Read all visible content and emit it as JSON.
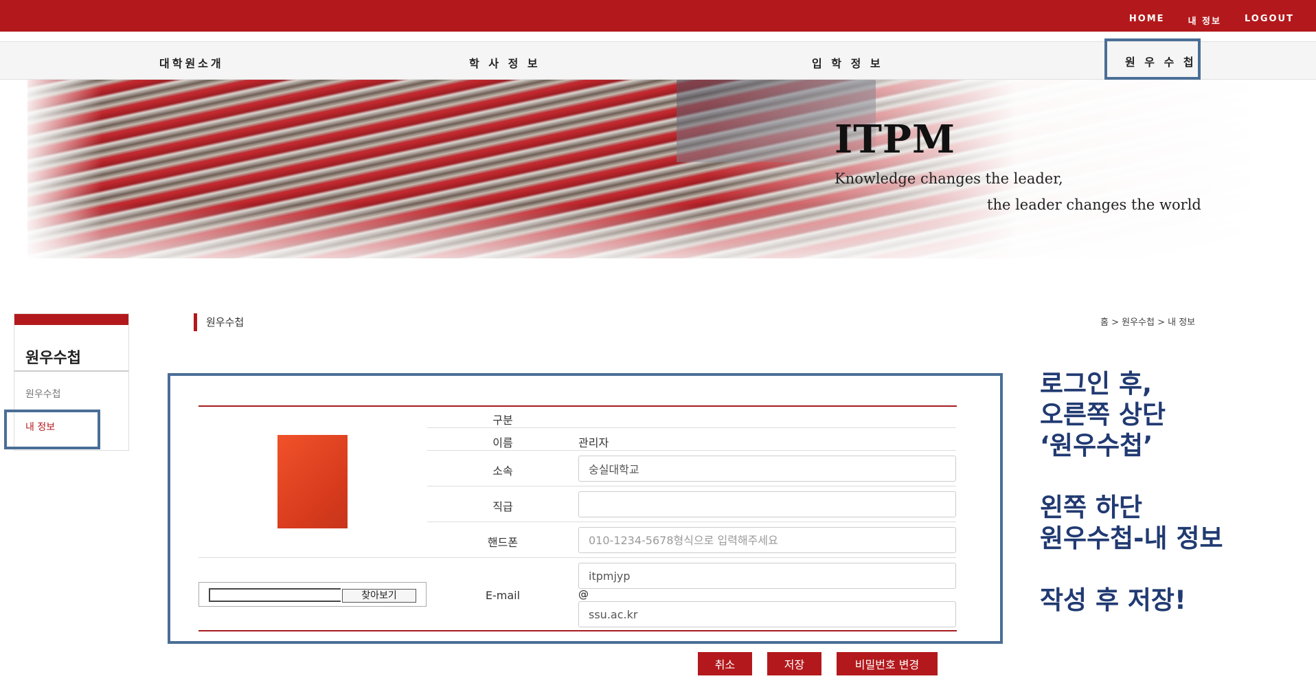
{
  "topbar": {
    "links": [
      "HOME",
      "내 정보",
      "LOGOUT"
    ]
  },
  "nav": {
    "items": [
      "대학원소개",
      "학 사 정 보",
      "입 학 정 보",
      "원 우 수 첩"
    ]
  },
  "banner": {
    "title": "ITPM",
    "tagline_1": "Knowledge changes the leader,",
    "tagline_2": "the leader changes the world"
  },
  "sidebar": {
    "title": "원우수첩",
    "items": [
      "원우수첩",
      "내 정보"
    ]
  },
  "section": {
    "title": "원우수첩",
    "breadcrumb": "홈 > 원우수첩 > 내 정보"
  },
  "form": {
    "file_button": "찾아보기",
    "rows": {
      "division": {
        "label": "구분",
        "value": ""
      },
      "name": {
        "label": "이름",
        "value": "관리자"
      },
      "affiliation": {
        "label": "소속",
        "value": "숭실대학교"
      },
      "position": {
        "label": "직급",
        "value": ""
      },
      "phone": {
        "label": "핸드폰",
        "placeholder": "010-1234-5678형식으로 입력해주세요"
      },
      "email": {
        "label": "E-mail",
        "user": "itpmjyp",
        "at": "@",
        "domain": "ssu.ac.kr"
      }
    }
  },
  "buttons": {
    "cancel": "취소",
    "save": "저장",
    "change_password": "비밀번호 변경"
  },
  "annotation": {
    "line1": "로그인 후,",
    "line2": "오른쪽 상단",
    "line3": "‘원우수첩’",
    "line4": "왼쪽 하단",
    "line5": "원우수첩-내 정보",
    "line6": "작성 후 저장!"
  },
  "colors": {
    "brand_red": "#b3191c",
    "highlight_blue": "#4a6e96",
    "annotation_navy": "#213a72"
  }
}
